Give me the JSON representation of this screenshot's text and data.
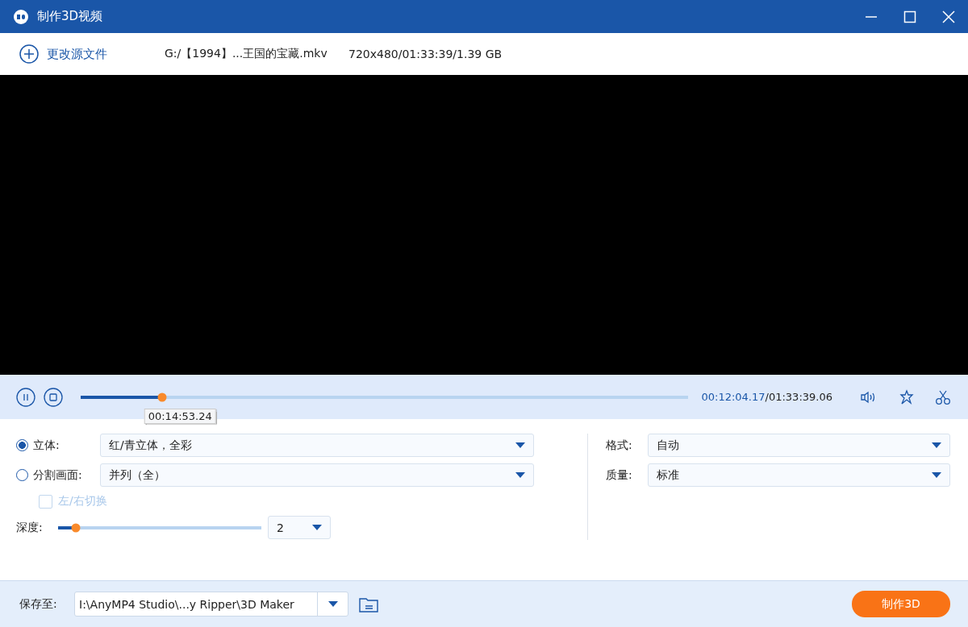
{
  "window": {
    "title": "制作3D视频"
  },
  "source": {
    "change_label": "更改源文件",
    "file": "G:/【1994】...王国的宝藏.mkv",
    "info": "720x480/01:33:39/1.39 GB"
  },
  "player": {
    "playing": true,
    "level": 0.134,
    "tooltip": "00:14:53.24",
    "current": "00:12:04.17",
    "total": "/01:33:39.06"
  },
  "modes": [
    {
      "label": "立体:",
      "selected": true,
      "value": "红/青立体，全彩"
    },
    {
      "label": "分割画面:",
      "selected": false,
      "value": "并列（全）"
    }
  ],
  "swap": {
    "label": "左/右切换",
    "checked": false,
    "disabled": true
  },
  "depth": {
    "label": "深度:",
    "level": 0.087,
    "value": "2"
  },
  "output": [
    {
      "label": "格式:",
      "value": "自动"
    },
    {
      "label": "质量:",
      "value": "标准"
    }
  ],
  "save": {
    "label": "保存至:",
    "path": "I:\\AnyMP4 Studio\\...y Ripper\\3D Maker",
    "button": "制作3D"
  }
}
